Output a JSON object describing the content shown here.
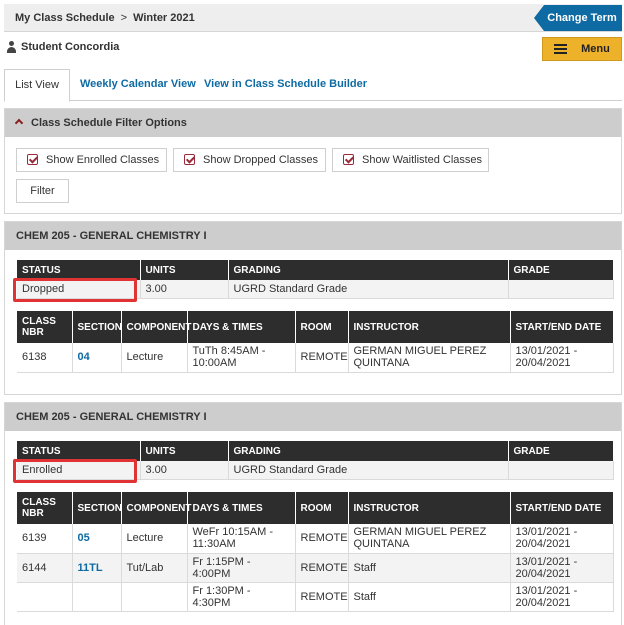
{
  "header": {
    "breadcrumb_home": "My Class Schedule",
    "breadcrumb_sep": ">",
    "breadcrumb_term": "Winter 2021",
    "change_term": "Change Term",
    "user_name": "Student Concordia",
    "menu": "Menu"
  },
  "tabs": {
    "list": "List View",
    "calendar": "Weekly Calendar View",
    "builder": "View in Class Schedule Builder"
  },
  "filter": {
    "title": "Class Schedule Filter Options",
    "enrolled": "Show Enrolled Classes",
    "dropped": "Show Dropped Classes",
    "waitlisted": "Show Waitlisted Classes",
    "filter_btn": "Filter"
  },
  "summary_headers": {
    "status": "STATUS",
    "units": "UNITS",
    "grading": "GRADING",
    "grade": "GRADE"
  },
  "detail_headers": {
    "class_nbr_1": "CLASS",
    "class_nbr_2": "NBR",
    "section": "SECTION",
    "component": "COMPONENT",
    "days_times": "DAYS & TIMES",
    "room": "ROOM",
    "instructor": "INSTRUCTOR",
    "dates": "START/END DATE"
  },
  "courses": [
    {
      "title": "CHEM 205 - GENERAL CHEMISTRY I",
      "status": "Dropped",
      "units": "3.00",
      "grading": "UGRD Standard Grade",
      "grade": "",
      "rows": [
        {
          "nbr": "6138",
          "section": "04",
          "component": "Lecture",
          "days_1": "TuTh 8:45AM -",
          "days_2": "10:00AM",
          "room": "REMOTE",
          "instructor_1": "GERMAN MIGUEL PEREZ",
          "instructor_2": "QUINTANA",
          "date_1": "13/01/2021 -",
          "date_2": "20/04/2021"
        }
      ]
    },
    {
      "title": "CHEM 205 - GENERAL CHEMISTRY I",
      "status": "Enrolled",
      "units": "3.00",
      "grading": "UGRD Standard Grade",
      "grade": "",
      "rows": [
        {
          "nbr": "6139",
          "section": "05",
          "component": "Lecture",
          "days_1": "WeFr 10:15AM -",
          "days_2": "11:30AM",
          "room": "REMOTE",
          "instructor_1": "GERMAN MIGUEL PEREZ",
          "instructor_2": "QUINTANA",
          "date_1": "13/01/2021 -",
          "date_2": "20/04/2021"
        },
        {
          "nbr": "6144",
          "section": "11TL",
          "component": "Tut/Lab",
          "days_1": "Fr 1:15PM - 4:00PM",
          "days_2": "",
          "room": "REMOTE",
          "instructor_1": "Staff",
          "instructor_2": "",
          "date_1": "13/01/2021 -",
          "date_2": "20/04/2021"
        },
        {
          "nbr": "",
          "section": "",
          "component": "",
          "days_1": "Fr 1:30PM - 4:30PM",
          "days_2": "",
          "room": "REMOTE",
          "instructor_1": "Staff",
          "instructor_2": "",
          "date_1": "13/01/2021 -",
          "date_2": "20/04/2021"
        }
      ]
    }
  ],
  "colors": {
    "accent_blue": "#0e6aa3",
    "menu_gold": "#eeb12a",
    "highlight_red": "#e03434",
    "header_dark": "#2d2d2d"
  }
}
